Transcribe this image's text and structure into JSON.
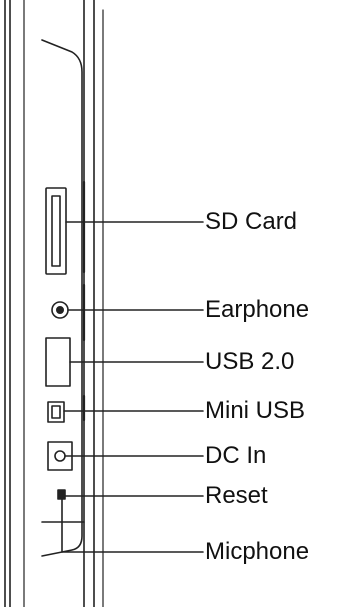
{
  "labels": {
    "sd_card": "SD Card",
    "earphone": "Earphone",
    "usb": "USB 2.0",
    "mini_usb": "Mini USB",
    "dc_in": "DC In",
    "reset": "Reset",
    "micphone": "Micphone"
  },
  "colors": {
    "line": "#222222",
    "background": "#ffffff"
  }
}
